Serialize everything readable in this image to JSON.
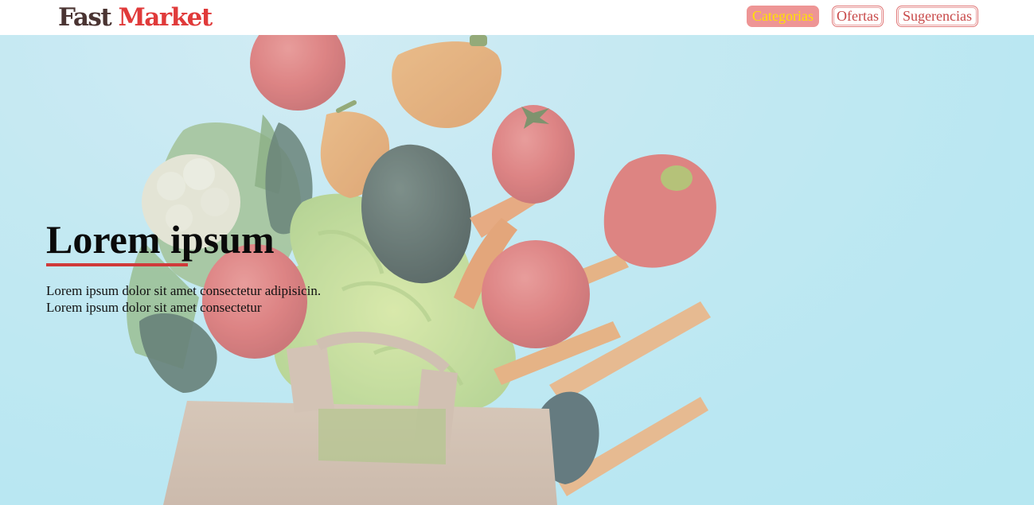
{
  "header": {
    "logo": {
      "first": "Fast",
      "second": "Market"
    },
    "nav": [
      {
        "label": "Categorias",
        "active": true
      },
      {
        "label": "Ofertas",
        "active": false
      },
      {
        "label": "Sugerencias",
        "active": false
      }
    ]
  },
  "hero": {
    "title": "Lorem ipsum",
    "lines": [
      "Lorem ipsum dolor sit amet consectetur adipisicin.",
      "Lorem ipsum dolor sit amet consectetur"
    ],
    "image": "grocery-bag-vegetables"
  },
  "colors": {
    "brand_dark": "#4a3432",
    "brand_red": "#e03a3a",
    "nav_active_bg": "#ee9595",
    "nav_active_text": "#ffe300",
    "nav_outline": "#c84848",
    "hero_bg": "#b2e5f0",
    "underline": "#d03a3a"
  }
}
